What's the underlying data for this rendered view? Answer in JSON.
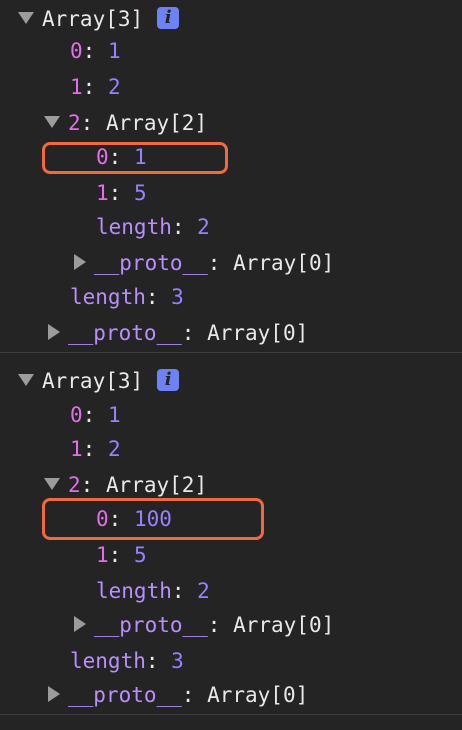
{
  "panels": [
    {
      "header": "Array[3]",
      "info_icon_glyph": "i",
      "items": [
        {
          "key": "0",
          "value": "1"
        },
        {
          "key": "1",
          "value": "2"
        },
        {
          "key": "2",
          "value": "Array[2]"
        }
      ],
      "nested": {
        "items": [
          {
            "key": "0",
            "value": "1"
          },
          {
            "key": "1",
            "value": "5"
          }
        ],
        "length_key": "length",
        "length_value": "2",
        "proto_key": "__proto__",
        "proto_value": "Array[0]"
      },
      "length_key": "length",
      "length_value": "3",
      "proto_key": "__proto__",
      "proto_value": "Array[0]"
    },
    {
      "header": "Array[3]",
      "info_icon_glyph": "i",
      "items": [
        {
          "key": "0",
          "value": "1"
        },
        {
          "key": "1",
          "value": "2"
        },
        {
          "key": "2",
          "value": "Array[2]"
        }
      ],
      "nested": {
        "items": [
          {
            "key": "0",
            "value": "100"
          },
          {
            "key": "1",
            "value": "5"
          }
        ],
        "length_key": "length",
        "length_value": "2",
        "proto_key": "__proto__",
        "proto_value": "Array[0]"
      },
      "length_key": "length",
      "length_value": "3",
      "proto_key": "__proto__",
      "proto_value": "Array[0]"
    }
  ],
  "colors": {
    "background": "#242424",
    "index_key": "#e36eec",
    "number_value": "#9980ff",
    "meta_key": "#b98eff",
    "highlight_box": "#f1693f",
    "info_badge": "#6c82f5"
  },
  "icons": {
    "expanded": "triangle-down-icon",
    "collapsed": "triangle-right-icon",
    "info": "info-icon"
  }
}
